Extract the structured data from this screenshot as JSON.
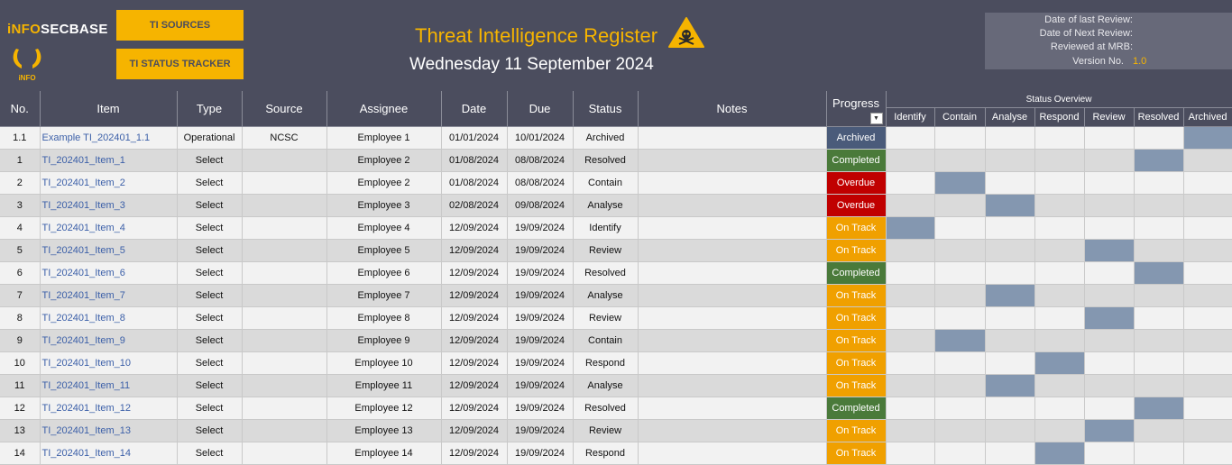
{
  "header": {
    "logo_part1": "iNFO",
    "logo_part2": "SECBASE",
    "logo_sub": "iNFO",
    "btn_sources": "TI SOURCES",
    "btn_tracker": "TI STATUS TRACKER",
    "title": "Threat Intelligence Register",
    "subtitle": "Wednesday 11 September 2024",
    "warning_icon": "hazard-skull-icon",
    "review": {
      "last_review": "Date of last Review:",
      "next_review": "Date of Next Review:",
      "reviewed_at": "Reviewed at MRB:",
      "version_label": "Version No.",
      "version_value": "1.0"
    }
  },
  "columns": {
    "no": "No.",
    "item": "Item",
    "type": "Type",
    "source": "Source",
    "assignee": "Assignee",
    "date": "Date",
    "due": "Due",
    "status": "Status",
    "notes": "Notes",
    "progress": "Progress",
    "status_overview": "Status Overview",
    "stages": [
      "Identify",
      "Contain",
      "Analyse",
      "Respond",
      "Review",
      "Resolved",
      "Archived"
    ]
  },
  "rows": [
    {
      "no": "1.1",
      "item": "Example TI_202401_1.1",
      "type": "Operational",
      "source": "NCSC",
      "assignee": "Employee 1",
      "date": "01/01/2024",
      "due": "10/01/2024",
      "status": "Archived",
      "notes": "",
      "progress": "Archived"
    },
    {
      "no": "1",
      "item": "TI_202401_Item_1",
      "type": "Select",
      "source": "",
      "assignee": "Employee 2",
      "date": "01/08/2024",
      "due": "08/08/2024",
      "status": "Resolved",
      "notes": "",
      "progress": "Completed"
    },
    {
      "no": "2",
      "item": "TI_202401_Item_2",
      "type": "Select",
      "source": "",
      "assignee": "Employee 2",
      "date": "01/08/2024",
      "due": "08/08/2024",
      "status": "Contain",
      "notes": "",
      "progress": "Overdue"
    },
    {
      "no": "3",
      "item": "TI_202401_Item_3",
      "type": "Select",
      "source": "",
      "assignee": "Employee 3",
      "date": "02/08/2024",
      "due": "09/08/2024",
      "status": "Analyse",
      "notes": "",
      "progress": "Overdue"
    },
    {
      "no": "4",
      "item": "TI_202401_Item_4",
      "type": "Select",
      "source": "",
      "assignee": "Employee 4",
      "date": "12/09/2024",
      "due": "19/09/2024",
      "status": "Identify",
      "notes": "",
      "progress": "On Track"
    },
    {
      "no": "5",
      "item": "TI_202401_Item_5",
      "type": "Select",
      "source": "",
      "assignee": "Employee 5",
      "date": "12/09/2024",
      "due": "19/09/2024",
      "status": "Review",
      "notes": "",
      "progress": "On Track"
    },
    {
      "no": "6",
      "item": "TI_202401_Item_6",
      "type": "Select",
      "source": "",
      "assignee": "Employee 6",
      "date": "12/09/2024",
      "due": "19/09/2024",
      "status": "Resolved",
      "notes": "",
      "progress": "Completed"
    },
    {
      "no": "7",
      "item": "TI_202401_Item_7",
      "type": "Select",
      "source": "",
      "assignee": "Employee 7",
      "date": "12/09/2024",
      "due": "19/09/2024",
      "status": "Analyse",
      "notes": "",
      "progress": "On Track"
    },
    {
      "no": "8",
      "item": "TI_202401_Item_8",
      "type": "Select",
      "source": "",
      "assignee": "Employee 8",
      "date": "12/09/2024",
      "due": "19/09/2024",
      "status": "Review",
      "notes": "",
      "progress": "On Track"
    },
    {
      "no": "9",
      "item": "TI_202401_Item_9",
      "type": "Select",
      "source": "",
      "assignee": "Employee 9",
      "date": "12/09/2024",
      "due": "19/09/2024",
      "status": "Contain",
      "notes": "",
      "progress": "On Track"
    },
    {
      "no": "10",
      "item": "TI_202401_Item_10",
      "type": "Select",
      "source": "",
      "assignee": "Employee 10",
      "date": "12/09/2024",
      "due": "19/09/2024",
      "status": "Respond",
      "notes": "",
      "progress": "On Track"
    },
    {
      "no": "11",
      "item": "TI_202401_Item_11",
      "type": "Select",
      "source": "",
      "assignee": "Employee 11",
      "date": "12/09/2024",
      "due": "19/09/2024",
      "status": "Analyse",
      "notes": "",
      "progress": "On Track"
    },
    {
      "no": "12",
      "item": "TI_202401_Item_12",
      "type": "Select",
      "source": "",
      "assignee": "Employee 12",
      "date": "12/09/2024",
      "due": "19/09/2024",
      "status": "Resolved",
      "notes": "",
      "progress": "Completed"
    },
    {
      "no": "13",
      "item": "TI_202401_Item_13",
      "type": "Select",
      "source": "",
      "assignee": "Employee 13",
      "date": "12/09/2024",
      "due": "19/09/2024",
      "status": "Review",
      "notes": "",
      "progress": "On Track"
    },
    {
      "no": "14",
      "item": "TI_202401_Item_14",
      "type": "Select",
      "source": "",
      "assignee": "Employee 14",
      "date": "12/09/2024",
      "due": "19/09/2024",
      "status": "Respond",
      "notes": "",
      "progress": "On Track"
    }
  ],
  "colors": {
    "header_bg": "#4b4d5e",
    "accent": "#f6b400",
    "archived": "#4a5b7a",
    "completed": "#4a7a3a",
    "overdue": "#c00000",
    "on_track": "#f0a000",
    "stage_marker": "#8497b0"
  }
}
